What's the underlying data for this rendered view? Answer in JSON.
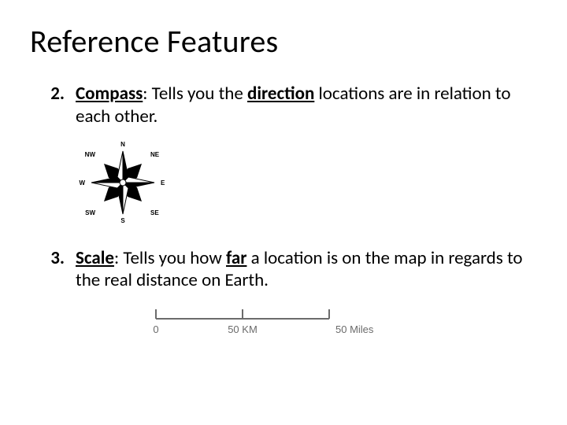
{
  "title": "Reference Features",
  "items": [
    {
      "number": "2.",
      "term": "Compass",
      "sep": ": ",
      "pre": "Tells you the ",
      "keyword": "direction",
      "post": " locations are in relation to each other."
    },
    {
      "number": "3.",
      "term": "Scale",
      "sep": ": ",
      "pre": "Tells you how ",
      "keyword": "far",
      "post": " a location is on the map in regards to the real distance on Earth."
    }
  ],
  "compass": {
    "labels": {
      "n": "N",
      "ne": "NE",
      "e": "E",
      "se": "SE",
      "s": "S",
      "sw": "SW",
      "w": "W",
      "nw": "NW"
    }
  },
  "scale": {
    "ticks": [
      "0",
      "50 KM",
      "50 Miles"
    ]
  }
}
